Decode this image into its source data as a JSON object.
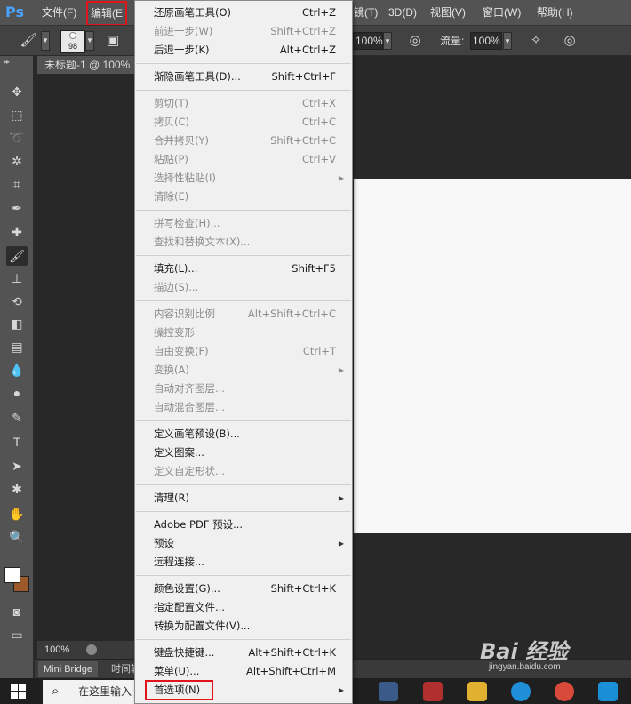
{
  "app": {
    "logo": "Ps"
  },
  "menubar": {
    "items": [
      "文件(F)",
      "编辑(E",
      "镜(T)",
      "3D(D)",
      "视图(V)",
      "窗口(W)",
      "帮助(H)"
    ],
    "highlighted": "编辑(E",
    "highlight_color": "#e0141a"
  },
  "options": {
    "brush_size": "98",
    "opacity_value": "100%",
    "flow_label": "流量:",
    "flow_value": "100%"
  },
  "document": {
    "tab_title": "未标题-1 @ 100%",
    "zoom": "100%",
    "canvas_color": "#f8f8f8"
  },
  "bottom_tabs": [
    "Mini Bridge",
    "时间轴"
  ],
  "tools": [
    "move-icon",
    "marquee-icon",
    "lasso-icon",
    "magic-wand-icon",
    "crop-icon",
    "eyedropper-icon",
    "healing-icon",
    "brush-icon",
    "stamp-icon",
    "history-brush-icon",
    "eraser-icon",
    "gradient-icon",
    "blur-icon",
    "dodge-icon",
    "pen-icon",
    "type-icon",
    "path-select-icon",
    "shape-icon",
    "hand-icon",
    "zoom-icon"
  ],
  "tool_glyphs": [
    "✥",
    "⬚",
    "➰",
    "✲",
    "⌗",
    "✒",
    "✚",
    "🖌",
    "⊥",
    "⟲",
    "◧",
    "▤",
    "💧",
    "●",
    "✎",
    "T",
    "➤",
    "✱",
    "✋",
    "🔍"
  ],
  "colors": {
    "foreground": "#ffffff",
    "background": "#9c5a2a"
  },
  "edit_menu": {
    "groups": [
      [
        {
          "label": "还原画笔工具(O)",
          "shortcut": "Ctrl+Z",
          "disabled": false
        },
        {
          "label": "前进一步(W)",
          "shortcut": "Shift+Ctrl+Z",
          "disabled": true
        },
        {
          "label": "后退一步(K)",
          "shortcut": "Alt+Ctrl+Z",
          "disabled": false
        }
      ],
      [
        {
          "label": "渐隐画笔工具(D)...",
          "shortcut": "Shift+Ctrl+F",
          "disabled": false
        }
      ],
      [
        {
          "label": "剪切(T)",
          "shortcut": "Ctrl+X",
          "disabled": true
        },
        {
          "label": "拷贝(C)",
          "shortcut": "Ctrl+C",
          "disabled": true
        },
        {
          "label": "合并拷贝(Y)",
          "shortcut": "Shift+Ctrl+C",
          "disabled": true
        },
        {
          "label": "粘贴(P)",
          "shortcut": "Ctrl+V",
          "disabled": true
        },
        {
          "label": "选择性粘贴(I)",
          "shortcut": "",
          "disabled": true,
          "submenu": true
        },
        {
          "label": "清除(E)",
          "shortcut": "",
          "disabled": true
        }
      ],
      [
        {
          "label": "拼写检查(H)...",
          "shortcut": "",
          "disabled": true
        },
        {
          "label": "查找和替换文本(X)...",
          "shortcut": "",
          "disabled": true
        }
      ],
      [
        {
          "label": "填充(L)...",
          "shortcut": "Shift+F5",
          "disabled": false
        },
        {
          "label": "描边(S)...",
          "shortcut": "",
          "disabled": true
        }
      ],
      [
        {
          "label": "内容识别比例",
          "shortcut": "Alt+Shift+Ctrl+C",
          "disabled": true
        },
        {
          "label": "操控变形",
          "shortcut": "",
          "disabled": true
        },
        {
          "label": "自由变换(F)",
          "shortcut": "Ctrl+T",
          "disabled": true
        },
        {
          "label": "变换(A)",
          "shortcut": "",
          "disabled": true,
          "submenu": true
        },
        {
          "label": "自动对齐图层...",
          "shortcut": "",
          "disabled": true
        },
        {
          "label": "自动混合图层...",
          "shortcut": "",
          "disabled": true
        }
      ],
      [
        {
          "label": "定义画笔预设(B)...",
          "shortcut": "",
          "disabled": false
        },
        {
          "label": "定义图案...",
          "shortcut": "",
          "disabled": false
        },
        {
          "label": "定义自定形状...",
          "shortcut": "",
          "disabled": true
        }
      ],
      [
        {
          "label": "清理(R)",
          "shortcut": "",
          "disabled": false,
          "submenu": true
        }
      ],
      [
        {
          "label": "Adobe PDF 预设...",
          "shortcut": "",
          "disabled": false
        },
        {
          "label": "预设",
          "shortcut": "",
          "disabled": false,
          "submenu": true
        },
        {
          "label": "远程连接...",
          "shortcut": "",
          "disabled": false
        }
      ],
      [
        {
          "label": "颜色设置(G)...",
          "shortcut": "Shift+Ctrl+K",
          "disabled": false
        },
        {
          "label": "指定配置文件...",
          "shortcut": "",
          "disabled": false
        },
        {
          "label": "转换为配置文件(V)...",
          "shortcut": "",
          "disabled": false
        }
      ],
      [
        {
          "label": "键盘快捷键...",
          "shortcut": "Alt+Shift+Ctrl+K",
          "disabled": false
        },
        {
          "label": "菜单(U)...",
          "shortcut": "Alt+Shift+Ctrl+M",
          "disabled": false
        },
        {
          "label": "首选项(N)",
          "shortcut": "",
          "disabled": false,
          "submenu": true,
          "highlighted": true
        }
      ]
    ]
  },
  "taskbar": {
    "search_placeholder": "在这里输入"
  },
  "watermark": {
    "brand": "Bai 经验",
    "url": "jingyan.baidu.com"
  }
}
